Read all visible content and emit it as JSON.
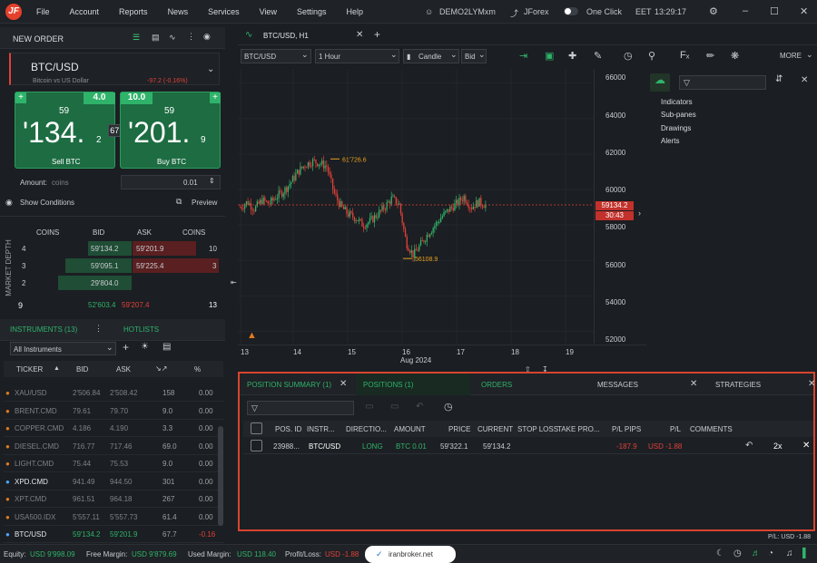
{
  "menu": {
    "items": [
      "File",
      "Account",
      "Reports",
      "News",
      "Services",
      "View",
      "Settings",
      "Help"
    ],
    "account": "DEMO2LYMxm",
    "platform": "JForex",
    "oneclick": "One Click",
    "timezone": "EET",
    "time": "13:29:17"
  },
  "neworder": {
    "title": "NEW ORDER",
    "instrument": "BTC/USD",
    "description": "Bitcoin vs US Dollar",
    "change": "-97.2 (-0.16%)",
    "sell_top": "59",
    "sell_big": "'134.",
    "sell_sub": "2",
    "sell_label": "Sell BTC",
    "sell_spread_val": "4.0",
    "buy_top": "59",
    "buy_big": "'201.",
    "buy_sub": "9",
    "buy_label": "Buy BTC",
    "buy_spread_val": "10.0",
    "spread": "67.7",
    "amount_label": "Amount:",
    "amount_unit": "coins",
    "amount_value": "0.01",
    "show_conditions": "Show Conditions",
    "preview": "Preview"
  },
  "depth": {
    "side_label": "MARKET DEPTH",
    "headers": [
      "COINS",
      "BID",
      "ASK",
      "COINS"
    ],
    "rows": [
      {
        "lvl": "4",
        "bid": "59'134.2",
        "ask": "59'201.9",
        "coins": "10"
      },
      {
        "lvl": "3",
        "bid": "59'095.1",
        "ask": "59'225.4",
        "coins": "3"
      },
      {
        "lvl": "2",
        "bid": "29'804.0",
        "ask": "",
        "coins": ""
      }
    ],
    "total": {
      "lvl": "9",
      "bid": "52'603.4",
      "ask": "59'207.4",
      "coins": "13"
    }
  },
  "instruments": {
    "tab1": "INSTRUMENTS (13)",
    "tab2": "HOTLISTS",
    "filter": "All Instruments",
    "headers": [
      "TICKER",
      "BID",
      "ASK",
      "",
      ""
    ],
    "rows": [
      {
        "t": "XAU/USD",
        "b": "2'506.84",
        "a": "2'508.42",
        "s": "158",
        "p": "0.00"
      },
      {
        "t": "BRENT.CMD",
        "b": "79.61",
        "a": "79.70",
        "s": "9.0",
        "p": "0.00"
      },
      {
        "t": "COPPER.CMD",
        "b": "4.186",
        "a": "4.190",
        "s": "3.3",
        "p": "0.00"
      },
      {
        "t": "DIESEL.CMD",
        "b": "716.77",
        "a": "717.46",
        "s": "69.0",
        "p": "0.00"
      },
      {
        "t": "LIGHT.CMD",
        "b": "75.44",
        "a": "75.53",
        "s": "9.0",
        "p": "0.00"
      },
      {
        "t": "XPD.CMD",
        "b": "941.49",
        "a": "944.50",
        "s": "301",
        "p": "0.00"
      },
      {
        "t": "XPT.CMD",
        "b": "961.51",
        "a": "964.18",
        "s": "267",
        "p": "0.00"
      },
      {
        "t": "USA500.IDX",
        "b": "5'557.11",
        "a": "5'557.73",
        "s": "61.4",
        "p": "0.00"
      },
      {
        "t": "BTC/USD",
        "b": "59'134.2",
        "a": "59'201.9",
        "s": "67.7",
        "p": "-0.16"
      }
    ]
  },
  "chart": {
    "tab": "BTC/USD, H1",
    "instrument": "BTC/USD",
    "period": "1 Hour",
    "type": "Candle",
    "side": "Bid",
    "more": "MORE",
    "high_label": "61'726.6",
    "low_label": "56108.9",
    "price_tag": "59134.2",
    "time_tag": "30:43",
    "x_labels": [
      "13",
      "14",
      "15",
      "16",
      "17",
      "18",
      "19"
    ],
    "x_month": "Aug 2024",
    "y_labels": [
      "66000",
      "64000",
      "62000",
      "60000",
      "58000",
      "56000",
      "54000",
      "52000"
    ],
    "side_items": [
      "Indicators",
      "Sub-panes",
      "Drawings",
      "Alerts"
    ]
  },
  "chart_data": {
    "type": "candlestick",
    "instrument": "BTC/USD",
    "period": "1 Hour",
    "ylim": [
      51000,
      66500
    ],
    "x_ticks": [
      "13",
      "14",
      "15",
      "16",
      "17",
      "18",
      "19"
    ],
    "high": 61726.6,
    "low": 56108.9,
    "last": 59134.2
  },
  "positions": {
    "tabs": [
      "POSITION SUMMARY (1)",
      "POSITIONS (1)",
      "ORDERS",
      "MESSAGES",
      "STRATEGIES"
    ],
    "headers": [
      "POS. ID",
      "INSTR...",
      "DIRECTIO...",
      "AMOUNT",
      "PRICE",
      "CURRENT",
      "STOP LOSS",
      "TAKE PRO...",
      "P/L PIPS",
      "P/L",
      "COMMENTS"
    ],
    "row": {
      "id": "23988...",
      "instr": "BTC/USD",
      "dir": "LONG",
      "amount": "BTC 0.01",
      "price": "59'322.1",
      "current": "59'134.2",
      "sl": "",
      "tp": "",
      "pips": "-187.9",
      "pl": "USD -1.88",
      "comments": ""
    },
    "mult": "2x",
    "pl_footer": "P/L: USD -1.88"
  },
  "status": {
    "equity_l": "Equity:",
    "equity": "USD 9'998.09",
    "free_l": "Free Margin:",
    "free": "USD 9'879.69",
    "used_l": "Used Margin:",
    "used": "USD 118.40",
    "pl_l": "Profit/Loss:",
    "pl": "USD -1.88",
    "badge": "iranbroker.net"
  }
}
